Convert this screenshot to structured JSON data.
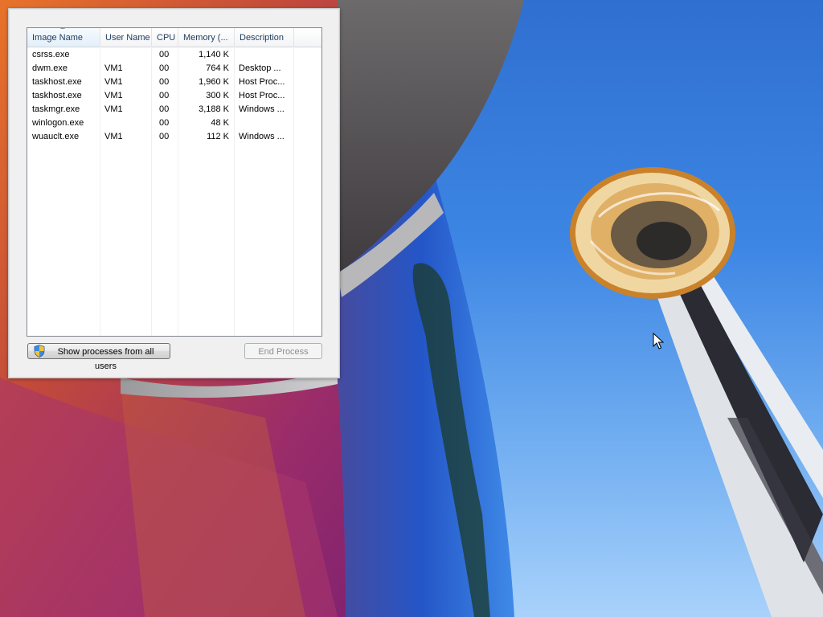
{
  "task_manager": {
    "columns": {
      "image_name": "Image Name",
      "user_name": "User Name",
      "cpu": "CPU",
      "memory": "Memory (...",
      "description": "Description"
    },
    "processes": [
      {
        "name": "csrss.exe",
        "user": "",
        "cpu": "00",
        "memory": "1,140 K",
        "description": ""
      },
      {
        "name": "dwm.exe",
        "user": "VM1",
        "cpu": "00",
        "memory": "764 K",
        "description": "Desktop ..."
      },
      {
        "name": "taskhost.exe",
        "user": "VM1",
        "cpu": "00",
        "memory": "1,960 K",
        "description": "Host Proc..."
      },
      {
        "name": "taskhost.exe",
        "user": "VM1",
        "cpu": "00",
        "memory": "300 K",
        "description": "Host Proc..."
      },
      {
        "name": "taskmgr.exe",
        "user": "VM1",
        "cpu": "00",
        "memory": "3,188 K",
        "description": "Windows ..."
      },
      {
        "name": "winlogon.exe",
        "user": "",
        "cpu": "00",
        "memory": "48 K",
        "description": ""
      },
      {
        "name": "wuauclt.exe",
        "user": "VM1",
        "cpu": "00",
        "memory": "112 K",
        "description": "Windows ..."
      }
    ],
    "show_all_button": "Show processes from all users",
    "end_process_button": "End Process",
    "sorted_column": "image_name"
  },
  "icons": {
    "shield": "uac-shield-icon",
    "cursor": "mouse-pointer-icon"
  },
  "colors": {
    "sky": "#3d86e4",
    "header_text": "#1e395b",
    "tower_gold": "#c9822a"
  }
}
